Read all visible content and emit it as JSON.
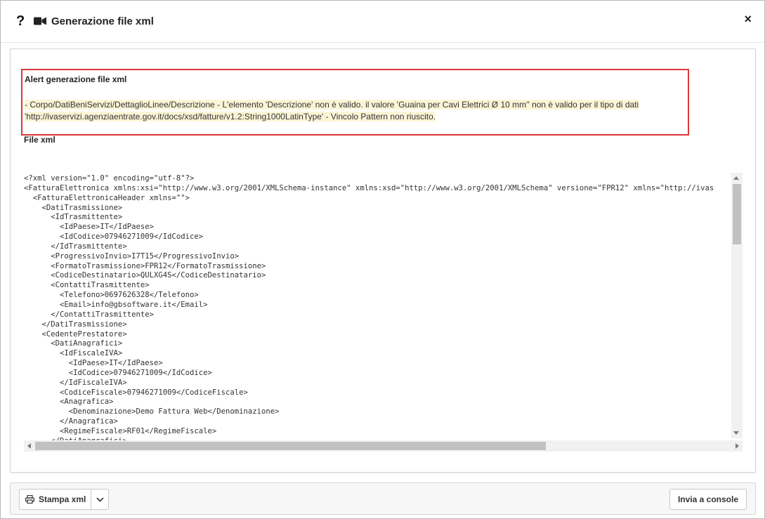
{
  "header": {
    "help_glyph": "?",
    "title": "Generazione file xml",
    "close_glyph": "×"
  },
  "alert": {
    "title": "Alert generazione file xml",
    "message_line1": "- Corpo/DatiBeniServizi/DettaglioLinee/Descrizione - L'elemento 'Descrizione' non è valido. il valore 'Guaina per Cavi Elettrici Ø 10 mm'' non è valido per il tipo di dati",
    "message_line2": "'http://ivaservizi.agenziaentrate.gov.it/docs/xsd/fatture/v1.2:String1000LatinType' - Vincolo Pattern non riuscito."
  },
  "file_xml": {
    "label": "File xml",
    "lines": [
      "<?xml version=\"1.0\" encoding=\"utf-8\"?>",
      "<FatturaElettronica xmlns:xsi=\"http://www.w3.org/2001/XMLSchema-instance\" xmlns:xsd=\"http://www.w3.org/2001/XMLSchema\" versione=\"FPR12\" xmlns=\"http://ivas",
      "  <FatturaElettronicaHeader xmlns=\"\">",
      "    <DatiTrasmissione>",
      "      <IdTrasmittente>",
      "        <IdPaese>IT</IdPaese>",
      "        <IdCodice>07946271009</IdCodice>",
      "      </IdTrasmittente>",
      "      <ProgressivoInvio>I7T15</ProgressivoInvio>",
      "      <FormatoTrasmissione>FPR12</FormatoTrasmissione>",
      "      <CodiceDestinatario>QULXG4S</CodiceDestinatario>",
      "      <ContattiTrasmittente>",
      "        <Telefono>0697626328</Telefono>",
      "        <Email>info@gbsoftware.it</Email>",
      "      </ContattiTrasmittente>",
      "    </DatiTrasmissione>",
      "    <CedentePrestatore>",
      "      <DatiAnagrafici>",
      "        <IdFiscaleIVA>",
      "          <IdPaese>IT</IdPaese>",
      "          <IdCodice>07946271009</IdCodice>",
      "        </IdFiscaleIVA>",
      "        <CodiceFiscale>07946271009</CodiceFiscale>",
      "        <Anagrafica>",
      "          <Denominazione>Demo Fattura Web</Denominazione>",
      "        </Anagrafica>",
      "        <RegimeFiscale>RF01</RegimeFiscale>",
      "      </DatiAnagrafici>"
    ]
  },
  "footer": {
    "print_label": "Stampa xml",
    "console_label": "Invia a console"
  },
  "icons": {
    "help": "question-mark-icon",
    "title": "video-camera-icon",
    "close": "close-icon",
    "print": "printer-icon",
    "dropdown": "chevron-down-icon"
  },
  "colors": {
    "alert_border": "#d9383a",
    "alert_highlight": "#fbf5d6"
  }
}
